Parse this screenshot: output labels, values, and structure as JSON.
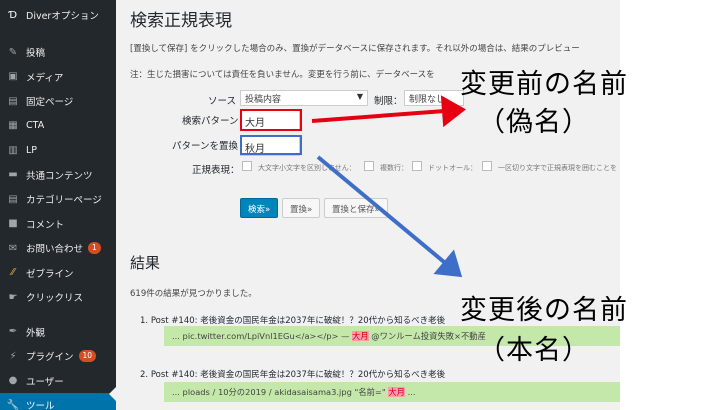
{
  "sidebar": {
    "items": [
      {
        "label": "Diverオプション",
        "icon": "diver-logo-icon"
      },
      {
        "label": "投稿",
        "icon": "pin-icon"
      },
      {
        "label": "メディア",
        "icon": "media-icon"
      },
      {
        "label": "固定ページ",
        "icon": "page-icon"
      },
      {
        "label": "CTA",
        "icon": "cta-icon"
      },
      {
        "label": "LP",
        "icon": "lp-icon"
      },
      {
        "label": "共通コンテンツ",
        "icon": "chat-icon"
      },
      {
        "label": "カテゴリーページ",
        "icon": "category-icon"
      },
      {
        "label": "コメント",
        "icon": "comment-icon"
      },
      {
        "label": "お問い合わせ",
        "icon": "mail-icon",
        "badge": "1"
      },
      {
        "label": "ゼブライン",
        "icon": "line-icon"
      },
      {
        "label": "クリックリス",
        "icon": "click-icon"
      },
      {
        "label": "外観",
        "icon": "brush-icon"
      },
      {
        "label": "プラグイン",
        "icon": "plugin-icon",
        "badge": "10"
      },
      {
        "label": "ユーザー",
        "icon": "user-icon"
      },
      {
        "label": "ツール",
        "icon": "wrench-icon"
      }
    ]
  },
  "main": {
    "title": "検索正規表現",
    "note1": "[置換して保存] をクリックした場合のみ、置換がデータベースに保存されます。それ以外の場合は、結果のプレビュー",
    "note2": "注：生じた損害については責任を負いません。変更を行う前に、データベースを",
    "source_label": "ソース",
    "source_value": "投稿内容",
    "limit_label": "制限：",
    "limit_value": "制限なし",
    "search_label": "検索パターン",
    "search_value": "大月",
    "replace_label": "パターンを置換",
    "replace_value": "秋月",
    "regex_label": "正規表現：",
    "checkbox_labels": [
      "大文字小文字を区別しません：",
      "複数行：",
      "ドットオール：",
      "一区切り文字で正規表現を囲むことを"
    ],
    "buttons": {
      "search": "検索»",
      "replace": "置換»",
      "replace_save": "置換と保存»"
    },
    "results_title": "結果",
    "results_count": "619件の結果が見つかりました。",
    "results": [
      {
        "num": "1.",
        "title": "Post #140: 老後資金の国民年金は2037年に破綻！？20代から知るべき老後",
        "snippet_pre": "... pic.twitter.com/LpiVnl1EGu</a></p> —",
        "snippet_hl": "大月",
        "snippet_post": "@ワンルーム投資失敗×不動産"
      },
      {
        "num": "2.",
        "title": "Post #140: 老後資金の国民年金は2037年に破綻！？20代から知るべき老後",
        "snippet_pre": "... ploads / 10分の2019 / akidasaisama3.jpg \"名前=\"",
        "snippet_hl": "大月",
        "snippet_post": "..."
      }
    ]
  },
  "annotations": {
    "before_line1": "変更前の名前",
    "before_line2": "（偽名）",
    "after_line1": "変更後の名前",
    "after_line2": "（本名）",
    "red_color": "#e60012",
    "blue_color": "#3d6fc8"
  }
}
